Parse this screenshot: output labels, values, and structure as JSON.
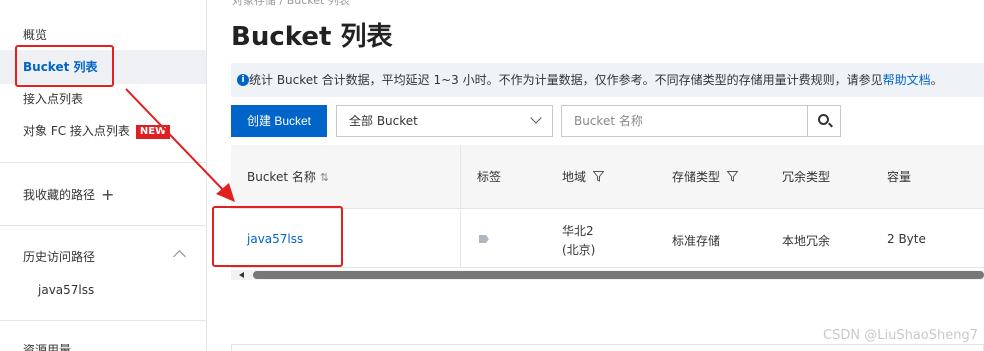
{
  "breadcrumb": "对象存储 / Bucket 列表",
  "sidebar": {
    "items": [
      {
        "label": "概览"
      },
      {
        "label": "Bucket 列表"
      },
      {
        "label": "接入点列表"
      },
      {
        "label": "对象 FC 接入点列表",
        "badge": "NEW"
      },
      {
        "label": "我收藏的路径",
        "icon": "plus-icon"
      },
      {
        "label": "历史访问路径",
        "icon": "chevron-up-icon"
      },
      {
        "label": "java57lss"
      },
      {
        "label": "资源用量"
      }
    ]
  },
  "main": {
    "title": "Bucket 列表",
    "notice": {
      "text": "统计 Bucket 合计数据，平均延迟 1~3 小时。不作为计量数据，仅作参考。不同存储类型的存储用量计费规则，请参见",
      "link": "帮助文档",
      "suffix": "。"
    },
    "toolbar": {
      "create_label": "创建 Bucket",
      "filter_value": "全部 Bucket",
      "search_placeholder": "Bucket 名称"
    },
    "table": {
      "headers": [
        "Bucket 名称",
        "标签",
        "地域",
        "存储类型",
        "冗余类型",
        "容量"
      ],
      "rows": [
        {
          "name": "java57lss",
          "region_line1": "华北2",
          "region_line2": "(北京)",
          "storage_class": "标准存储",
          "redundancy": "本地冗余",
          "capacity": "2 Byte"
        }
      ]
    }
  },
  "watermark": "CSDN @LiuShaoSheng7",
  "colors": {
    "accent": "#0064c8",
    "annotation": "#e32020",
    "badge": "#e02020"
  }
}
